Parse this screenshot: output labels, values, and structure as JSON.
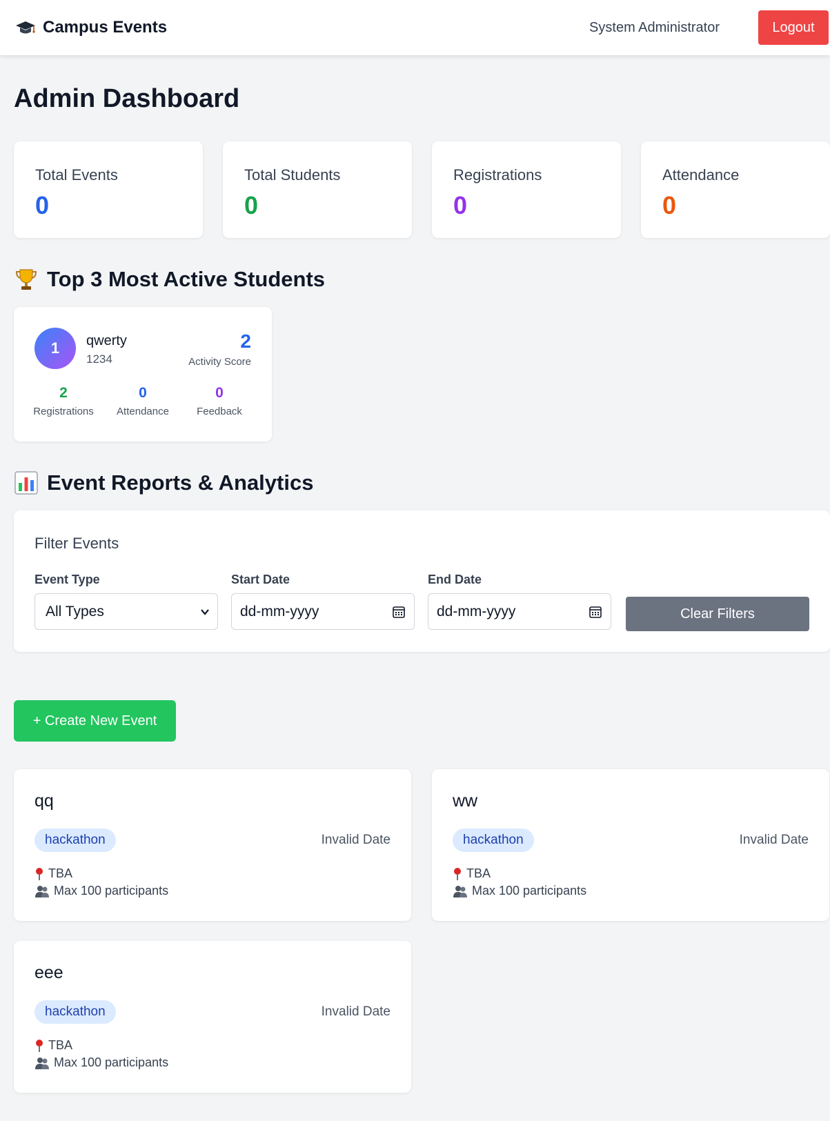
{
  "header": {
    "brand": "Campus Events",
    "brand_icon": "graduation-cap-icon",
    "user": "System Administrator",
    "logout_label": "Logout"
  },
  "page": {
    "title": "Admin Dashboard"
  },
  "stats": [
    {
      "label": "Total Events",
      "value": "0",
      "color": "#2563eb"
    },
    {
      "label": "Total Students",
      "value": "0",
      "color": "#16a34a"
    },
    {
      "label": "Registrations",
      "value": "0",
      "color": "#9333ea"
    },
    {
      "label": "Attendance",
      "value": "0",
      "color": "#ea580c"
    }
  ],
  "top_students": {
    "title": "Top 3 Most Active Students",
    "icon": "trophy-icon",
    "items": [
      {
        "rank": "1",
        "name": "qwerty",
        "id": "1234",
        "score": "2",
        "score_label": "Activity Score",
        "metrics": [
          {
            "value": "2",
            "label": "Registrations",
            "color": "#16a34a"
          },
          {
            "value": "0",
            "label": "Attendance",
            "color": "#2563eb"
          },
          {
            "value": "0",
            "label": "Feedback",
            "color": "#9333ea"
          }
        ]
      }
    ]
  },
  "reports": {
    "title": "Event Reports & Analytics",
    "icon": "bar-chart-icon",
    "filter_title": "Filter Events",
    "event_type": {
      "label": "Event Type",
      "value": "All Types"
    },
    "start_date": {
      "label": "Start Date",
      "value": "dd-mm-yyyy"
    },
    "end_date": {
      "label": "End Date",
      "value": "dd-mm-yyyy"
    },
    "clear_label": "Clear Filters"
  },
  "create_label": "+ Create New Event",
  "events": [
    {
      "title": "qq",
      "tag": "hackathon",
      "date": "Invalid Date",
      "location": "TBA",
      "capacity": "Max 100 participants"
    },
    {
      "title": "ww",
      "tag": "hackathon",
      "date": "Invalid Date",
      "location": "TBA",
      "capacity": "Max 100 participants"
    },
    {
      "title": "eee",
      "tag": "hackathon",
      "date": "Invalid Date",
      "location": "TBA",
      "capacity": "Max 100 participants"
    }
  ]
}
